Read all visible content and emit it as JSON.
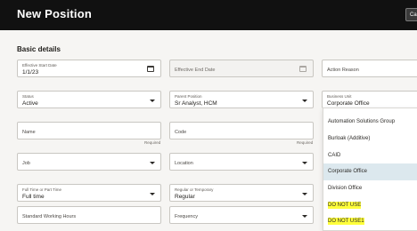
{
  "header": {
    "title": "New Position",
    "corner_button_label": "Ca"
  },
  "section": {
    "title": "Basic details"
  },
  "fields": {
    "effective_start_date": {
      "label": "Effective Start Date",
      "value": "1/1/23"
    },
    "effective_end_date": {
      "placeholder": "Effective End Date"
    },
    "action_reason": {
      "placeholder": "Action Reason"
    },
    "status": {
      "label": "Status",
      "value": "Active"
    },
    "parent_position": {
      "label": "Parent Position",
      "value": "Sr Analyst, HCM"
    },
    "business_unit": {
      "label": "Business Unit",
      "value": "Corporate Office"
    },
    "name": {
      "placeholder": "Name",
      "required_text": "Required"
    },
    "code": {
      "placeholder": "Code",
      "required_text": "Required"
    },
    "job": {
      "placeholder": "Job"
    },
    "location": {
      "placeholder": "Location"
    },
    "full_or_part_time": {
      "label": "Full Time or Part Time",
      "value": "Full time"
    },
    "regular_or_temporary": {
      "label": "Regular or Temporary",
      "value": "Regular"
    },
    "standard_working_hours": {
      "placeholder": "Standard Working Hours"
    },
    "frequency": {
      "placeholder": "Frequency"
    }
  },
  "business_unit_dropdown": {
    "options": [
      "Automation Solutions Group",
      "Burloak (Additive)",
      "CAID",
      "Corporate Office",
      "Division Office",
      "DO NOT USE",
      "DO NOT USE1"
    ],
    "selected": "Corporate Office",
    "highlight_color": "#ffff3b"
  },
  "colors": {
    "header_bg": "#111111",
    "page_bg": "#f6f5f3",
    "selected_option_bg": "#dce8ee"
  }
}
